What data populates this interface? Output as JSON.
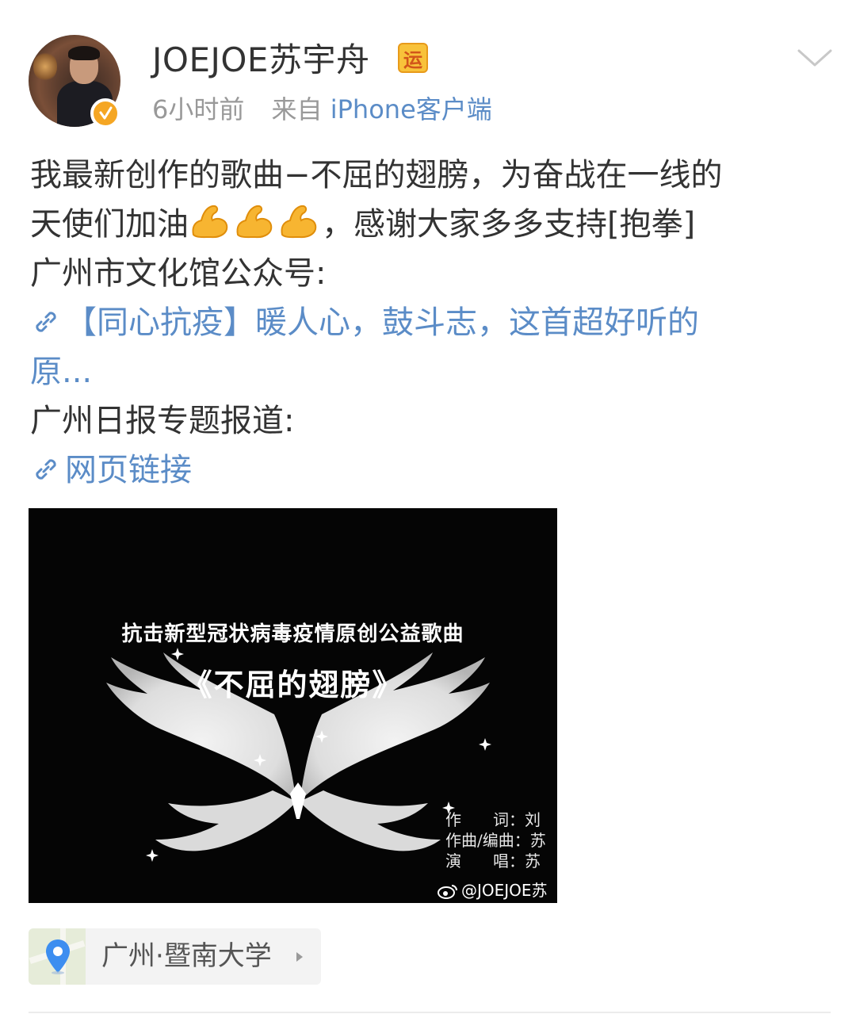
{
  "post": {
    "username": "JOEJOE苏宇舟",
    "badge": "运",
    "time": "6小时前",
    "source_prefix": "来自",
    "source_client": "iPhone客户端",
    "text_line1": "我最新创作的歌曲−不屈的翅膀，为奋战在一线的",
    "text_line2_a": "天使们加油",
    "text_line2_b": "，感谢大家多多支持[抱拳]",
    "text_line3": "广州市文化馆公众号:",
    "link1_line1": "【同心抗疫】暖人心，鼓斗志，这首超好听的",
    "link1_line2": "原...",
    "text_line4": "广州日报专题报道:",
    "link2": "网页链接"
  },
  "poster": {
    "subtitle": "抗击新型冠状病毒疫情原创公益歌曲",
    "title": "《不屈的翅膀》",
    "credit1": "作　　词：刘",
    "credit2": "作曲/编曲：苏",
    "credit3": "演　　唱：苏",
    "watermark": "@JOEJOE苏"
  },
  "location": {
    "label": "广州·暨南大学"
  },
  "colors": {
    "link": "#5b8cc7",
    "meta": "#999999",
    "verified": "#f5a623",
    "badge": "#f8c23a"
  },
  "icons": [
    "verified-icon",
    "chevron-down-icon",
    "flexed-biceps-icon",
    "link-icon",
    "weibo-icon",
    "location-pin-icon",
    "arrow-right-icon"
  ]
}
